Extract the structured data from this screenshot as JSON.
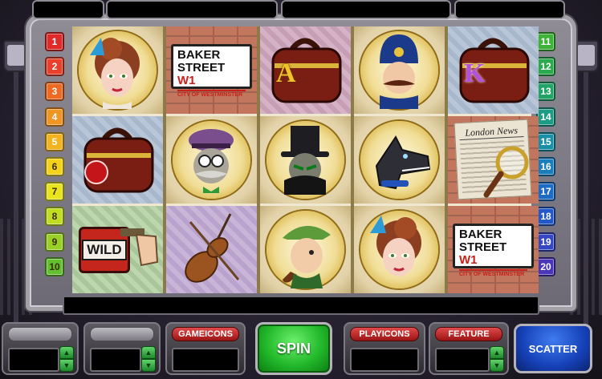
{
  "paylines_left": [
    "1",
    "2",
    "3",
    "4",
    "5",
    "6",
    "7",
    "8",
    "9",
    "10"
  ],
  "paylines_right": [
    "11",
    "12",
    "13",
    "14",
    "15",
    "16",
    "17",
    "18",
    "19",
    "20"
  ],
  "payline_colors": [
    "#e02a2a",
    "#e8402a",
    "#ee6a22",
    "#f09422",
    "#f4b21c",
    "#f4d31a",
    "#e8e41e",
    "#c2dc20",
    "#98d026",
    "#62c02e",
    "#3fb23a",
    "#2aaa4c",
    "#22a466",
    "#1c9c86",
    "#1a90a8",
    "#1a7ebc",
    "#1c6cc6",
    "#2258c8",
    "#3446c2",
    "#4a36b8"
  ],
  "reels": {
    "sign_line1": "BAKER",
    "sign_line2": "STREET",
    "sign_w1": "W1",
    "sign_line3": "CITY OF WESTMINSTER",
    "wild_label": "WILD",
    "newspaper_title": "London News",
    "card_A": "A",
    "card_K": "K"
  },
  "controls": {
    "gameicons_label": "GAMEICONS",
    "spin_label": "SPIN",
    "playicons_label": "PLAYICONS",
    "feature_label": "FEATURE",
    "scatter_label": "SCATTER"
  }
}
